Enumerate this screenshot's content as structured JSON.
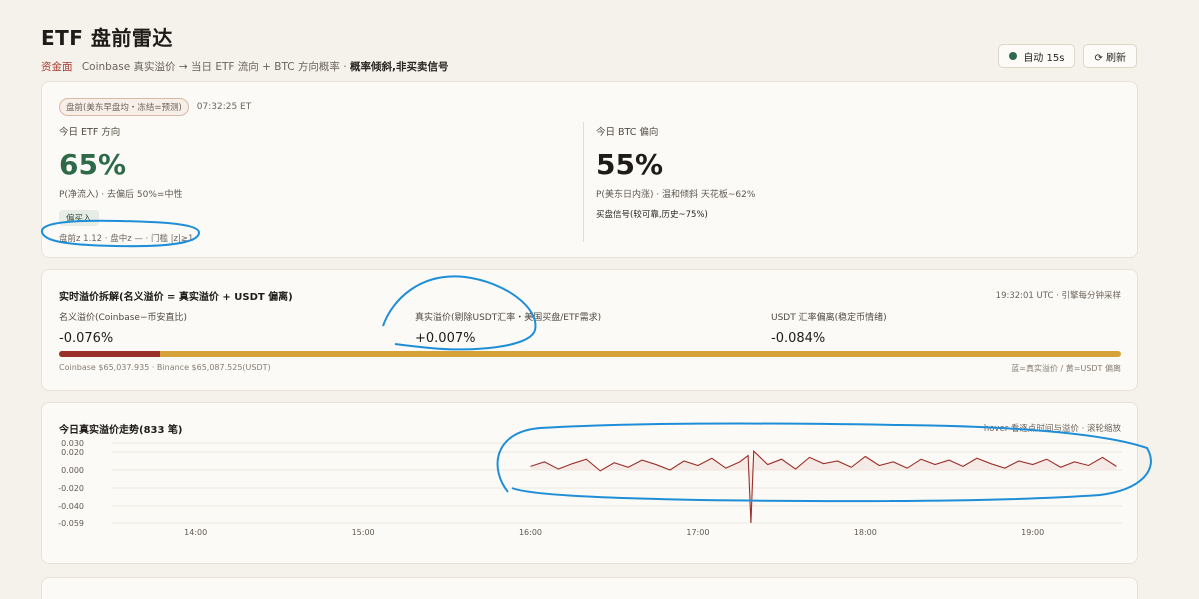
{
  "header": {
    "title": "ETF 盘前雷达",
    "brand": "资金面",
    "subtitle": "Coinbase 真实溢价 → 当日 ETF 流向 + BTC 方向概率 ·",
    "subtitle_strong": "概率倾斜,非买卖信号",
    "auto_label": "自动 15s",
    "refresh_label": "⟳ 刷新"
  },
  "status": {
    "session_badge": "盘前(美东早盘均・冻结=预测)",
    "time": "07:32:25 ET"
  },
  "etf": {
    "label": "今日 ETF 方向",
    "value": "65%",
    "desc": "P(净流入) · 去偏后 50%=中性",
    "tag": "偏买入",
    "meta": "盘前z 1.12 · 盘中z — · 门槛 |z|≥1"
  },
  "btc": {
    "label": "今日 BTC 偏向",
    "value": "55%",
    "desc": "P(美东日内涨) · 温和倾斜 天花板~62%",
    "signal": "买盘信号(较可靠,历史~75%)"
  },
  "breakdown": {
    "title": "实时溢价拆解(名义溢价 = 真实溢价 + USDT 偏离)",
    "right_note": "19:32:01 UTC · 引擎每分钟采样",
    "nominal_label": "名义溢价(Coinbase−币安直比)",
    "nominal_value": "-0.076%",
    "real_label": "真实溢价(剔除USDT汇率・美国买盘/ETF需求)",
    "real_value": "+0.007%",
    "usdt_label": "USDT 汇率偏离(稳定币情绪)",
    "usdt_value": "-0.084%",
    "real_fraction": 0.095,
    "footer_left": "Coinbase $65,037.935 · Binance $65,087.525(USDT)",
    "footer_right": "蓝=真实溢价 / 黄=USDT 偏离"
  },
  "trend": {
    "title": "今日真实溢价走势(833 笔)",
    "right_note": "hover 看逐点时间与溢价 · 滚轮缩放"
  },
  "colors": {
    "accent_red": "#9b2f2a",
    "accent_gold": "#d7a239",
    "green": "#2e6a4a",
    "annotation_blue": "#1f8ed8"
  },
  "chart_data": {
    "type": "line",
    "title": "今日真实溢价走势(833 笔)",
    "xlabel": "",
    "ylabel": "",
    "x_ticks": [
      "14:00",
      "15:00",
      "16:00",
      "17:00",
      "18:00",
      "19:00"
    ],
    "y_ticks": [
      "0.030",
      "0.020",
      "0.000",
      "-0.020",
      "-0.040",
      "-0.059"
    ],
    "ylim": [
      -0.059,
      0.03
    ],
    "x_range": [
      "13:30",
      "19:32"
    ],
    "grid": true,
    "series": [
      {
        "x": [
          "16:00",
          "16:05",
          "16:10",
          "16:15",
          "16:20",
          "16:25",
          "16:30",
          "16:35",
          "16:40",
          "16:45",
          "16:50",
          "16:55",
          "17:00",
          "17:05",
          "17:10",
          "17:15",
          "17:18",
          "17:19",
          "17:20",
          "17:25",
          "17:30",
          "17:35",
          "17:40",
          "17:45",
          "17:50",
          "17:55",
          "18:00",
          "18:05",
          "18:10",
          "18:15",
          "18:20",
          "18:25",
          "18:30",
          "18:35",
          "18:40",
          "18:45",
          "18:50",
          "18:55",
          "19:00",
          "19:05",
          "19:10",
          "19:15",
          "19:20",
          "19:25",
          "19:30"
        ],
        "values": [
          0.004,
          0.009,
          0.001,
          0.007,
          0.012,
          -0.001,
          0.008,
          0.003,
          0.011,
          0.006,
          0.0,
          0.01,
          0.005,
          0.013,
          0.002,
          0.009,
          0.016,
          -0.059,
          0.021,
          0.006,
          0.012,
          0.001,
          0.014,
          0.007,
          0.01,
          0.003,
          0.015,
          0.005,
          0.009,
          0.002,
          0.012,
          0.006,
          0.011,
          0.004,
          0.013,
          0.007,
          0.002,
          0.01,
          0.006,
          0.012,
          0.003,
          0.009,
          0.005,
          0.014,
          0.004
        ]
      }
    ]
  }
}
